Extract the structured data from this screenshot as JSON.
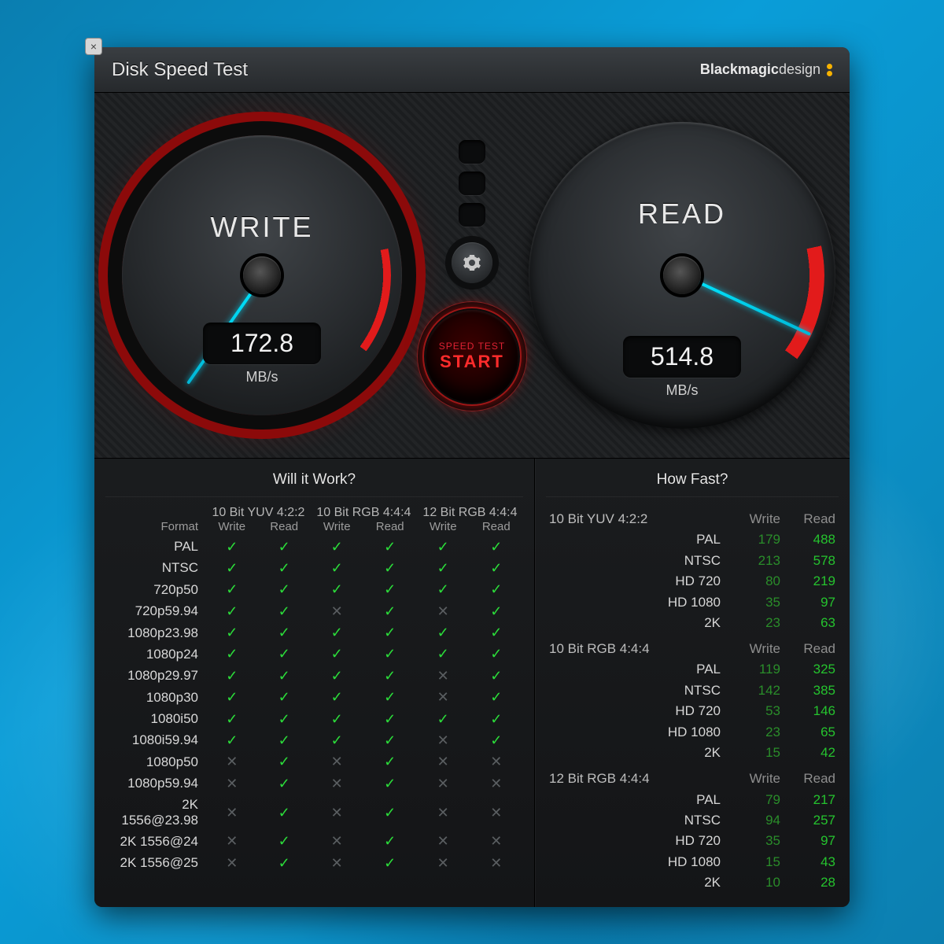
{
  "title": "Disk Speed Test",
  "brand": {
    "name": "Blackmagic",
    "suffix": "design"
  },
  "gauges": {
    "write": {
      "label": "WRITE",
      "value": "172.8",
      "unit": "MB/s",
      "needle_deg": 35
    },
    "read": {
      "label": "READ",
      "value": "514.8",
      "unit": "MB/s",
      "needle_deg": -65
    }
  },
  "start": {
    "small": "SPEED TEST",
    "big": "START"
  },
  "icons": {
    "gear": "gear-icon",
    "led": "status-led",
    "close": "×"
  },
  "willItWork": {
    "title": "Will it Work?",
    "groups": [
      "10 Bit YUV 4:2:2",
      "10 Bit RGB 4:4:4",
      "12 Bit RGB 4:4:4"
    ],
    "subcols": [
      "Write",
      "Read"
    ],
    "format_header": "Format",
    "rows": [
      {
        "fmt": "PAL",
        "cells": [
          true,
          true,
          true,
          true,
          true,
          true
        ]
      },
      {
        "fmt": "NTSC",
        "cells": [
          true,
          true,
          true,
          true,
          true,
          true
        ]
      },
      {
        "fmt": "720p50",
        "cells": [
          true,
          true,
          true,
          true,
          true,
          true
        ]
      },
      {
        "fmt": "720p59.94",
        "cells": [
          true,
          true,
          false,
          true,
          false,
          true
        ]
      },
      {
        "fmt": "1080p23.98",
        "cells": [
          true,
          true,
          true,
          true,
          true,
          true
        ]
      },
      {
        "fmt": "1080p24",
        "cells": [
          true,
          true,
          true,
          true,
          true,
          true
        ]
      },
      {
        "fmt": "1080p29.97",
        "cells": [
          true,
          true,
          true,
          true,
          false,
          true
        ]
      },
      {
        "fmt": "1080p30",
        "cells": [
          true,
          true,
          true,
          true,
          false,
          true
        ]
      },
      {
        "fmt": "1080i50",
        "cells": [
          true,
          true,
          true,
          true,
          true,
          true
        ]
      },
      {
        "fmt": "1080i59.94",
        "cells": [
          true,
          true,
          true,
          true,
          false,
          true
        ]
      },
      {
        "fmt": "1080p50",
        "cells": [
          false,
          true,
          false,
          true,
          false,
          false
        ]
      },
      {
        "fmt": "1080p59.94",
        "cells": [
          false,
          true,
          false,
          true,
          false,
          false
        ]
      },
      {
        "fmt": "2K 1556@23.98",
        "cells": [
          false,
          true,
          false,
          true,
          false,
          false
        ]
      },
      {
        "fmt": "2K 1556@24",
        "cells": [
          false,
          true,
          false,
          true,
          false,
          false
        ]
      },
      {
        "fmt": "2K 1556@25",
        "cells": [
          false,
          true,
          false,
          true,
          false,
          false
        ]
      }
    ]
  },
  "howFast": {
    "title": "How Fast?",
    "col_write": "Write",
    "col_read": "Read",
    "groups": [
      {
        "name": "10 Bit YUV 4:2:2",
        "rows": [
          {
            "fmt": "PAL",
            "write": 179,
            "read": 488
          },
          {
            "fmt": "NTSC",
            "write": 213,
            "read": 578
          },
          {
            "fmt": "HD 720",
            "write": 80,
            "read": 219
          },
          {
            "fmt": "HD 1080",
            "write": 35,
            "read": 97
          },
          {
            "fmt": "2K",
            "write": 23,
            "read": 63
          }
        ]
      },
      {
        "name": "10 Bit RGB 4:4:4",
        "rows": [
          {
            "fmt": "PAL",
            "write": 119,
            "read": 325
          },
          {
            "fmt": "NTSC",
            "write": 142,
            "read": 385
          },
          {
            "fmt": "HD 720",
            "write": 53,
            "read": 146
          },
          {
            "fmt": "HD 1080",
            "write": 23,
            "read": 65
          },
          {
            "fmt": "2K",
            "write": 15,
            "read": 42
          }
        ]
      },
      {
        "name": "12 Bit RGB 4:4:4",
        "rows": [
          {
            "fmt": "PAL",
            "write": 79,
            "read": 217
          },
          {
            "fmt": "NTSC",
            "write": 94,
            "read": 257
          },
          {
            "fmt": "HD 720",
            "write": 35,
            "read": 97
          },
          {
            "fmt": "HD 1080",
            "write": 15,
            "read": 43
          },
          {
            "fmt": "2K",
            "write": 10,
            "read": 28
          }
        ]
      }
    ]
  }
}
